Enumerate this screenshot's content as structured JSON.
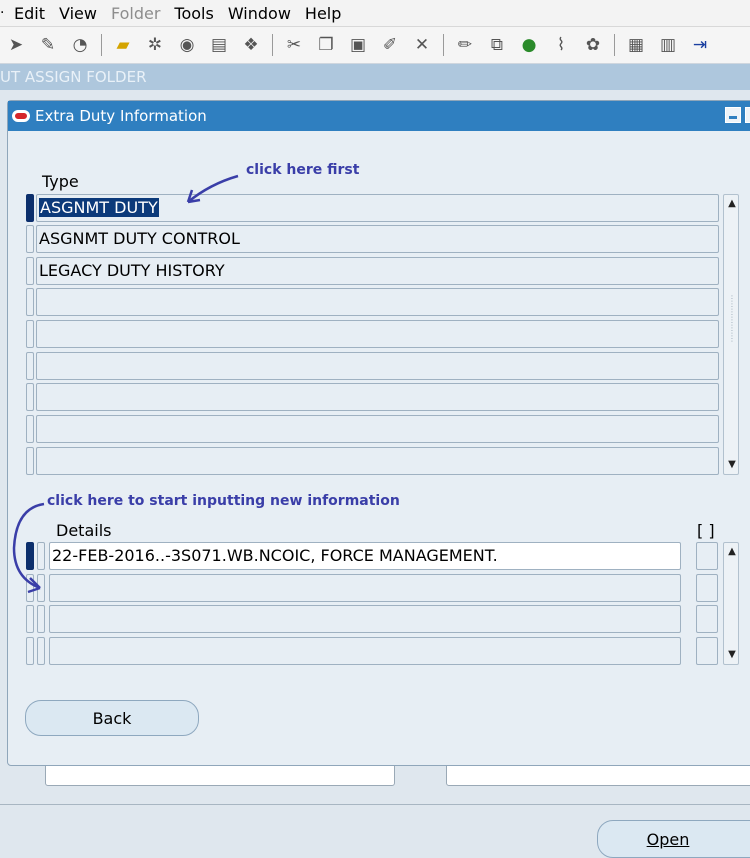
{
  "menu": {
    "items": [
      {
        "label": "Edit",
        "disabled": false
      },
      {
        "label": "View",
        "disabled": false
      },
      {
        "label": "Folder",
        "disabled": true
      },
      {
        "label": "Tools",
        "disabled": false
      },
      {
        "label": "Window",
        "disabled": false
      },
      {
        "label": "Help",
        "disabled": false
      }
    ]
  },
  "toolbar": {
    "icons": [
      "navigator-icon",
      "zoom-icon",
      "save-icon",
      "tools-icon",
      "print-icon",
      "find-icon",
      "cut-icon",
      "copy-icon",
      "paste-icon",
      "edit-record-icon",
      "delete-icon",
      "edit-field-icon",
      "zoom-form-icon",
      "translations-icon",
      "attachments-icon",
      "folder-tools-icon",
      "calendar-icon",
      "clear-icon",
      "exit-icon"
    ]
  },
  "background": {
    "form_title": "UT ASSIGN FOLDER",
    "open_button": "Open"
  },
  "dialog": {
    "title": "Extra Duty Information",
    "type_label": "Type",
    "type_rows": [
      "ASGNMT DUTY",
      "ASGNMT DUTY CONTROL",
      "LEGACY DUTY HISTORY",
      "",
      "",
      "",
      "",
      "",
      ""
    ],
    "details_label": "Details",
    "flex_label": "[ ]",
    "details_rows": [
      "22-FEB-2016..-3S071.WB.NCOIC, FORCE MANAGEMENT.",
      "",
      "",
      ""
    ],
    "back_button": "Back"
  },
  "annotations": {
    "first": "click here first",
    "second": "click here to start inputting new information"
  },
  "colors": {
    "titlebar": "#2f7fc0",
    "selection": "#0c3a7a",
    "annotation": "#3a3ea8",
    "form_bg": "#e7eef4"
  }
}
